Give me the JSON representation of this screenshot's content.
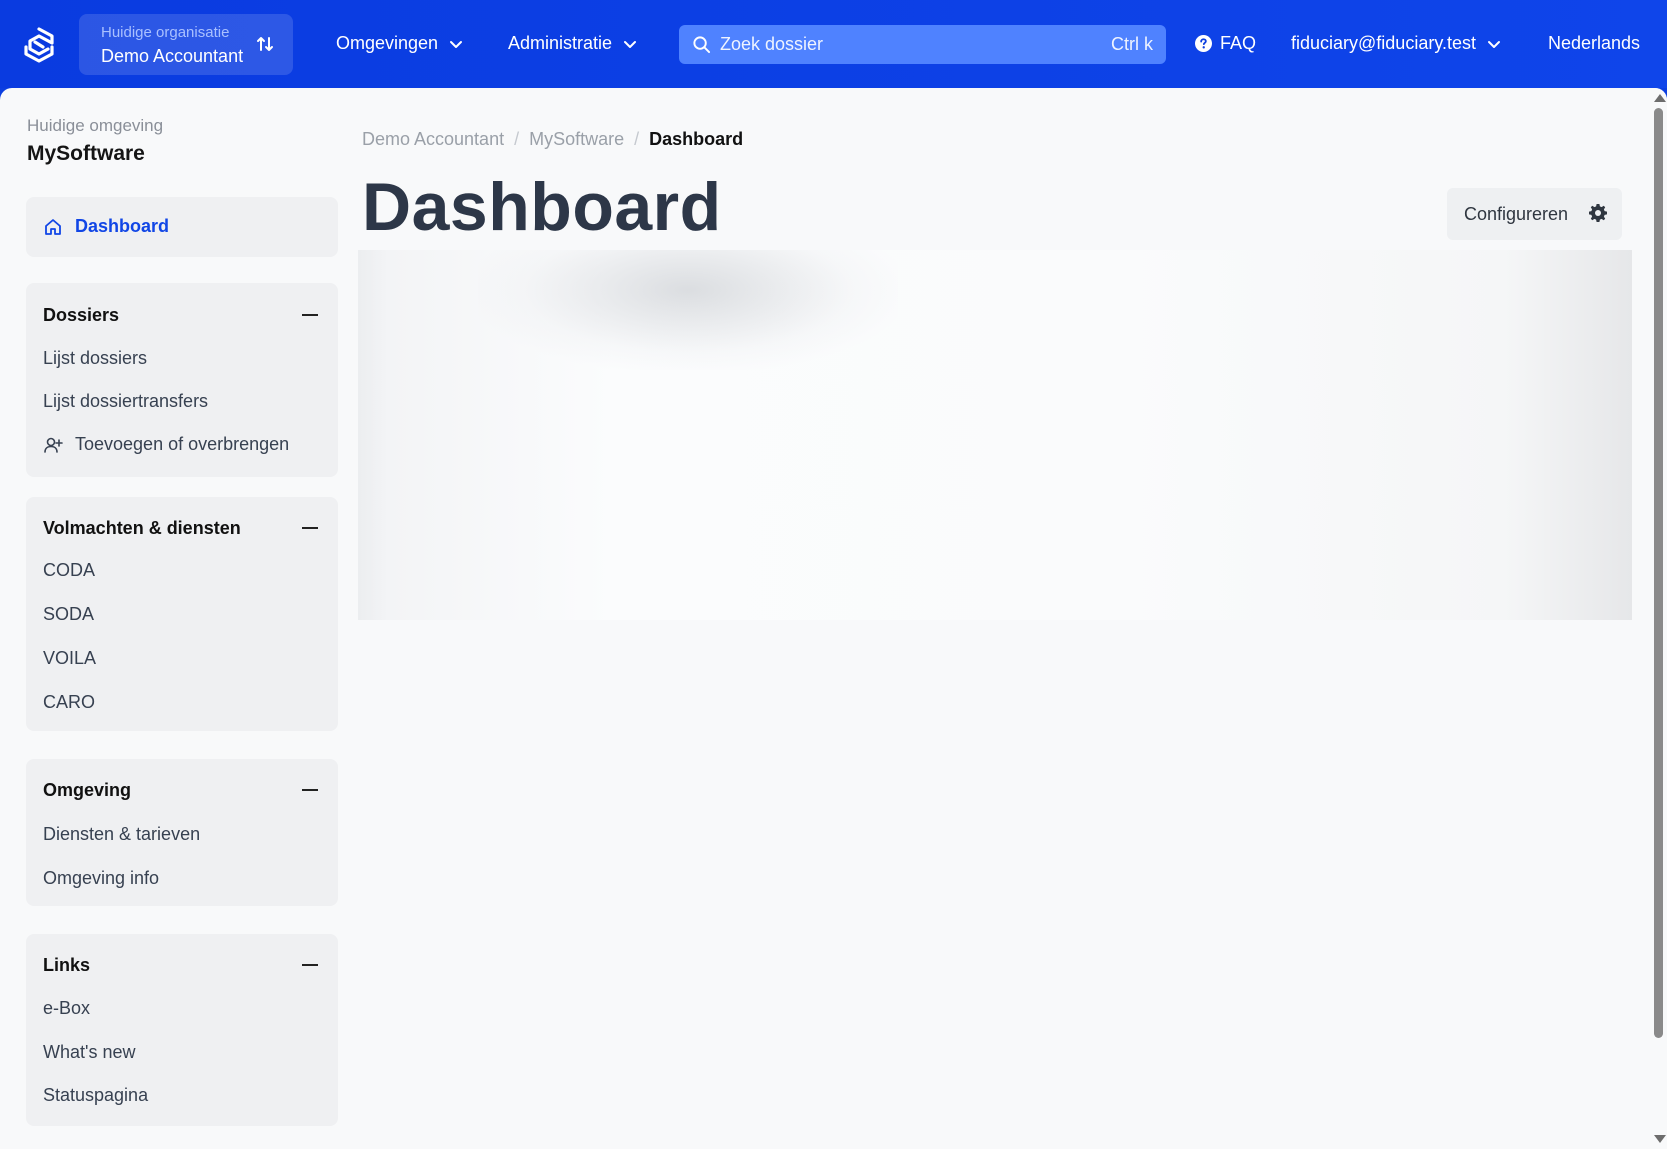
{
  "header": {
    "org_label": "Huidige organisatie",
    "org_name": "Demo Accountant",
    "nav": {
      "environments": "Omgevingen",
      "administration": "Administratie",
      "faq": "FAQ",
      "user_email": "fiduciary@fiduciary.test",
      "language": "Nederlands"
    },
    "search": {
      "placeholder": "Zoek dossier",
      "shortcut": "Ctrl k"
    }
  },
  "sidebar": {
    "env_label": "Huidige omgeving",
    "env_name": "MySoftware",
    "dashboard_label": "Dashboard",
    "sections": [
      {
        "title": "Dossiers",
        "items": [
          "Lijst dossiers",
          "Lijst dossiertransfers",
          "Toevoegen of overbrengen"
        ]
      },
      {
        "title": "Volmachten & diensten",
        "items": [
          "CODA",
          "SODA",
          "VOILA",
          "CARO"
        ]
      },
      {
        "title": "Omgeving",
        "items": [
          "Diensten & tarieven",
          "Omgeving info"
        ]
      },
      {
        "title": "Links",
        "items": [
          "e-Box",
          "What's new",
          "Statuspagina"
        ]
      }
    ]
  },
  "main": {
    "breadcrumb": [
      "Demo Accountant",
      "MySoftware",
      "Dashboard"
    ],
    "breadcrumb_separator": "/",
    "title": "Dashboard",
    "configure_label": "Configureren"
  },
  "colors": {
    "brand": "#0c3fe0",
    "accent_link": "#1146e6",
    "search_bg": "#4f82ff",
    "panel_bg": "#f8f9fa"
  }
}
